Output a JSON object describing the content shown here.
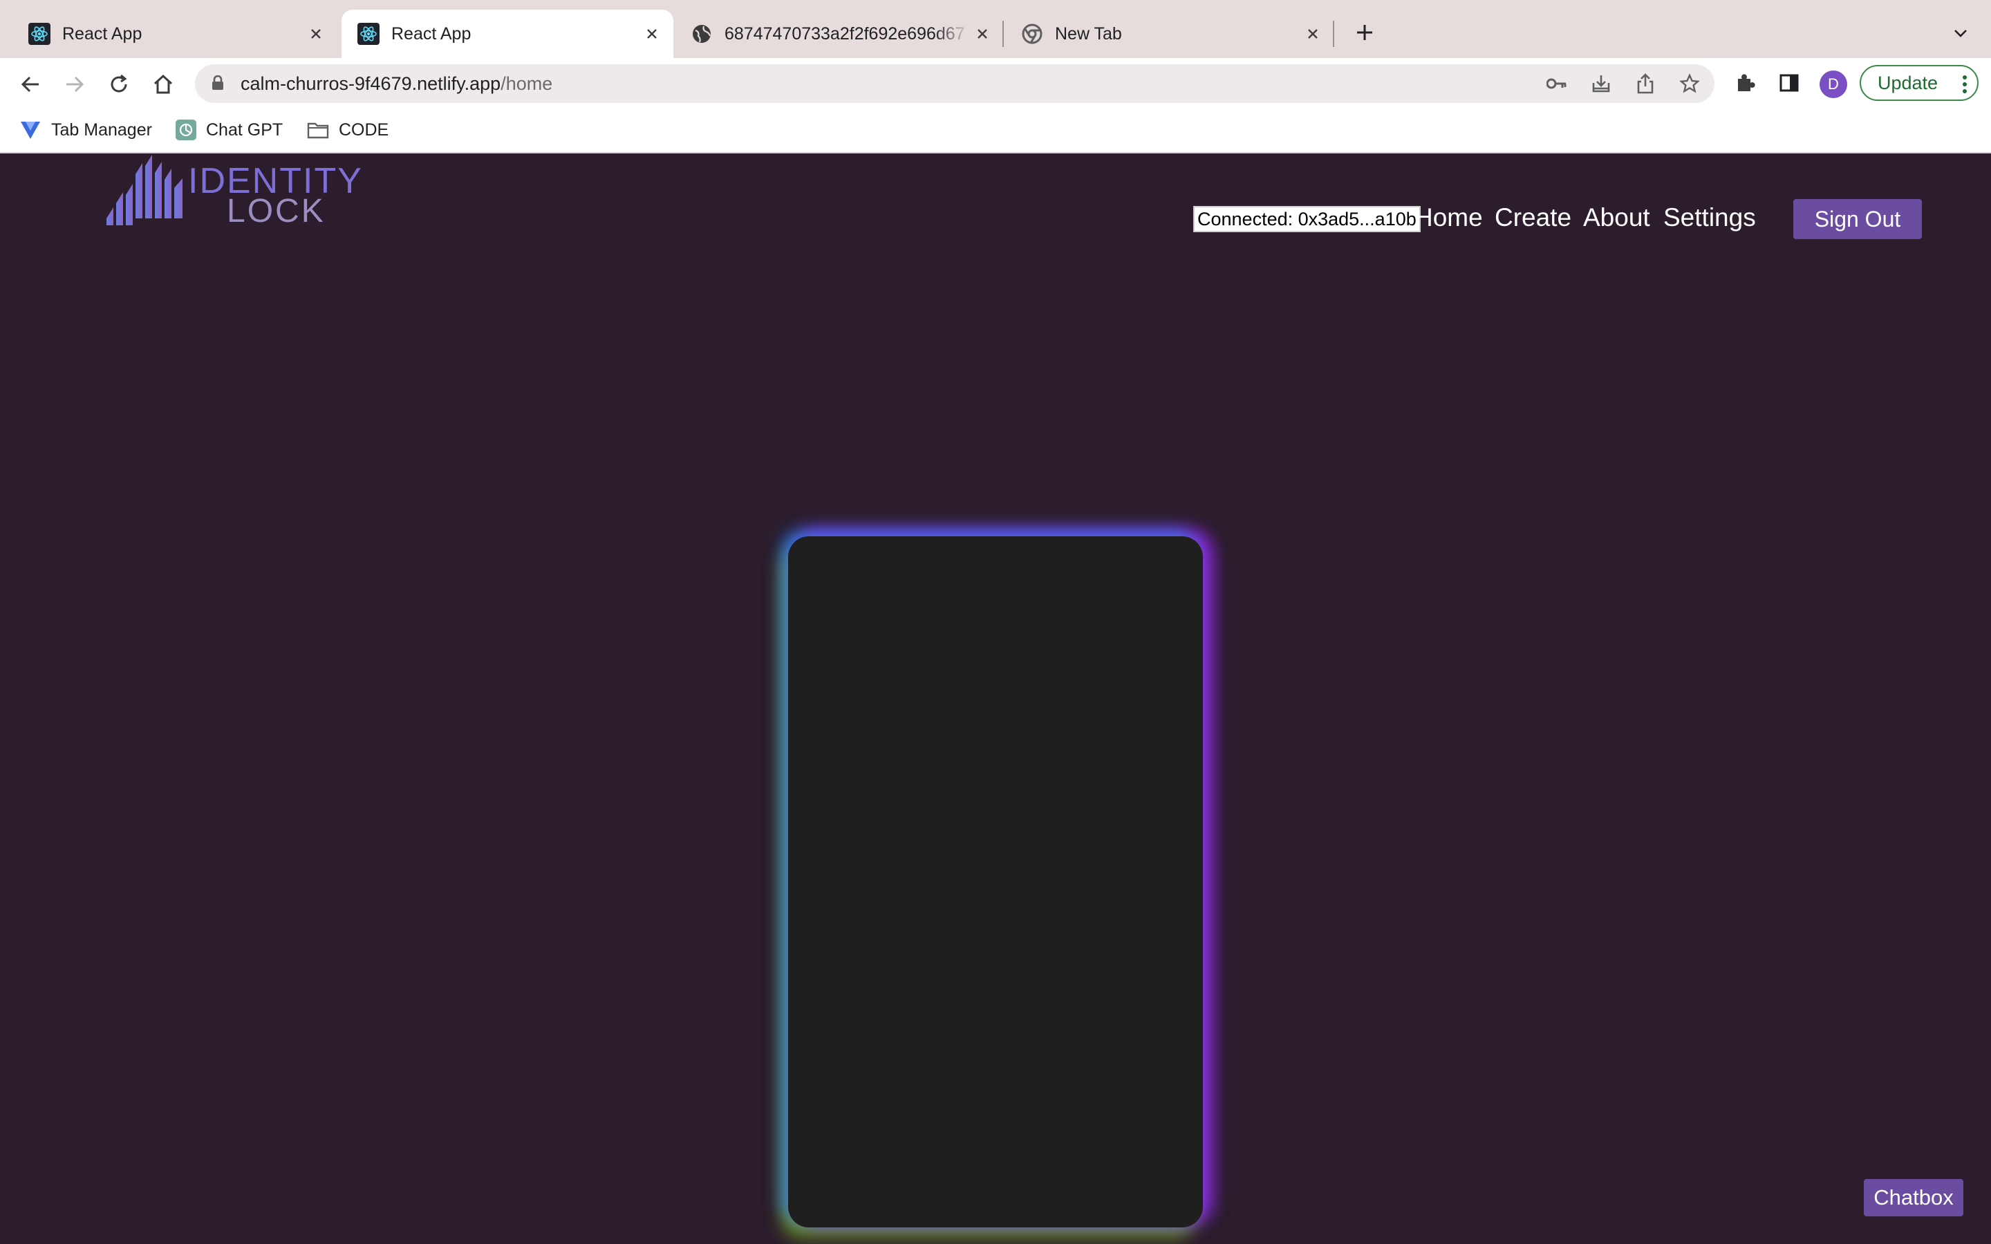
{
  "browser": {
    "tabs": [
      {
        "title": "React App",
        "icon": "react-icon",
        "active": false
      },
      {
        "title": "React App",
        "icon": "react-icon",
        "active": true
      },
      {
        "title": "68747470733a2f2f692e696d67",
        "icon": "globe-icon",
        "active": false
      },
      {
        "title": "New Tab",
        "icon": "chrome-icon",
        "active": false
      }
    ],
    "address": {
      "host": "calm-churros-9f4679.netlify.app",
      "path": "/home"
    },
    "profile_initial": "D",
    "update_label": "Update",
    "bookmarks": [
      {
        "label": "Tab Manager",
        "icon": "tab-manager-icon"
      },
      {
        "label": "Chat GPT",
        "icon": "chatgpt-icon"
      },
      {
        "label": "CODE",
        "icon": "folder-icon"
      }
    ]
  },
  "app": {
    "logo": {
      "line1": "IDENTITY",
      "line2": "LOCK"
    },
    "wallet_status": "Connected: 0x3ad5...a10b",
    "nav": [
      "Home",
      "Create",
      "About",
      "Settings"
    ],
    "signout_label": "Sign Out",
    "chatbox_label": "Chatbox",
    "colors": {
      "background": "#2b1d2b",
      "accent": "#6a4da0",
      "card": "#1f1f1f"
    }
  }
}
